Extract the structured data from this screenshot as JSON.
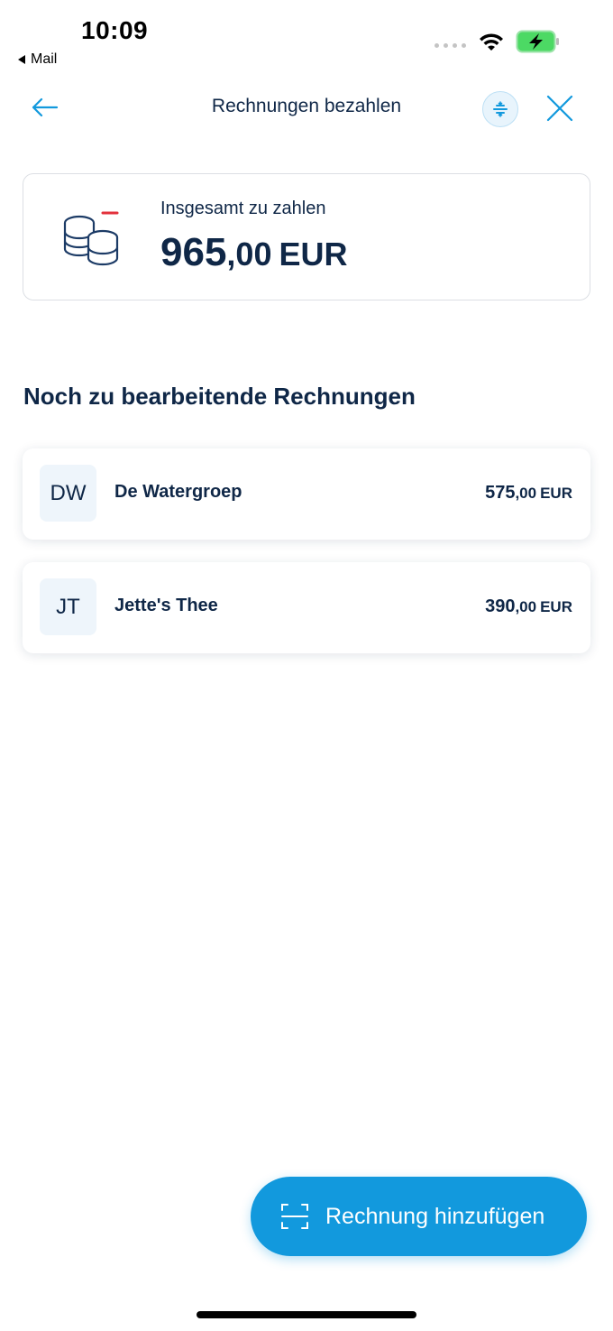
{
  "status_bar": {
    "time": "10:09",
    "back_app": "Mail"
  },
  "header": {
    "title": "Rechnungen bezahlen",
    "back_icon": "arrow-left-icon",
    "filter_icon": "filter-icon",
    "close_icon": "close-icon"
  },
  "total": {
    "label": "Insgesamt zu zahlen",
    "amount_int": "965",
    "amount_dec": ",00",
    "currency": "EUR",
    "icon": "coins-minus-icon"
  },
  "section_title": "Noch zu bearbeitende Rechnungen",
  "bills": [
    {
      "initials": "DW",
      "name": "De Watergroep",
      "amount_int": "575",
      "amount_dec": ",00",
      "currency": "EUR"
    },
    {
      "initials": "JT",
      "name": "Jette's Thee",
      "amount_int": "390",
      "amount_dec": ",00",
      "currency": "EUR"
    }
  ],
  "fab": {
    "label": "Rechnung hinzufügen",
    "icon": "scan-icon"
  },
  "colors": {
    "primary_text": "#0f2747",
    "accent": "#1299dd",
    "negative": "#e3323c"
  }
}
